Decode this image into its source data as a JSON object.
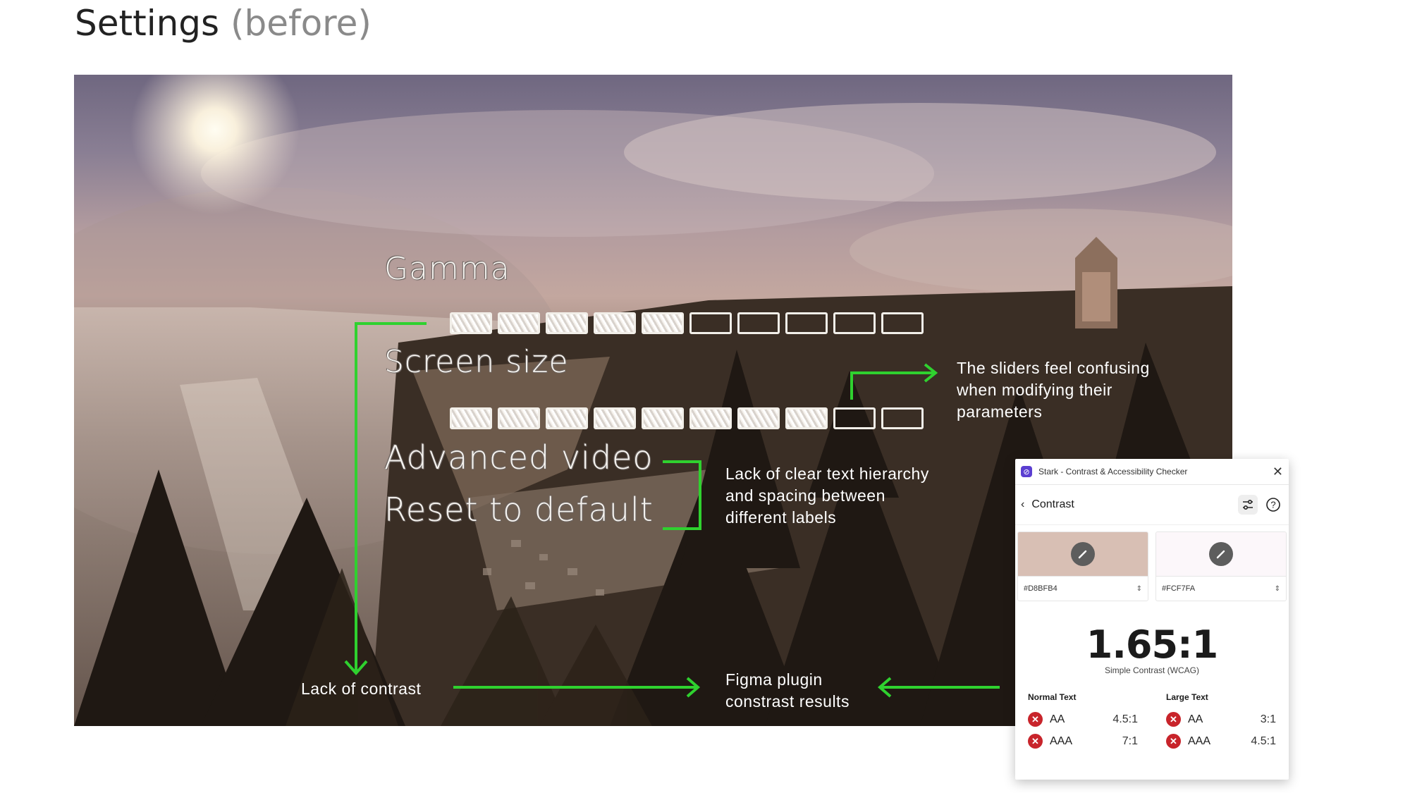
{
  "page": {
    "title": "Settings",
    "title_suffix": "(before)"
  },
  "game_menu": {
    "gamma_label": "Gamma",
    "gamma_level": 0.5,
    "screen_size_label": "Screen size",
    "screen_size_level": 0.8,
    "advanced_video_label": "Advanced video",
    "reset_label": "Reset to default"
  },
  "annotations": {
    "sliders": [
      "The sliders feel confusing",
      "when modifying their",
      "parameters"
    ],
    "hierarchy": [
      "Lack of clear text hierarchy",
      "and spacing between",
      "different labels"
    ],
    "contrast": "Lack of contrast",
    "figma": [
      "Figma plugin",
      "constrast results"
    ]
  },
  "stark": {
    "app_title": "Stark - Contrast & Accessibility Checker",
    "nav_title": "Contrast",
    "foreground": {
      "hex": "#D8BFB4",
      "color": "#D8BFB4"
    },
    "background": {
      "hex": "#FCF7FA",
      "color": "#FCF7FA"
    },
    "ratio": "1.65:1",
    "ratio_caption": "Simple Contrast (WCAG)",
    "normal_text": {
      "heading": "Normal Text",
      "aa": "AA",
      "aa_value": "4.5:1",
      "aaa": "AAA",
      "aaa_value": "7:1"
    },
    "large_text": {
      "heading": "Large Text",
      "aa": "AA",
      "aa_value": "3:1",
      "aaa": "AAA",
      "aaa_value": "4.5:1"
    },
    "icons": [
      "stark-logo-icon",
      "close-icon",
      "chevron-left-icon",
      "sliders-icon",
      "help-icon",
      "eyedropper-icon",
      "fail-icon"
    ]
  },
  "colors": {
    "annotation_green": "#2fd12f",
    "fail_red": "#c8242b",
    "stark_brand": "#5b3fd1"
  }
}
